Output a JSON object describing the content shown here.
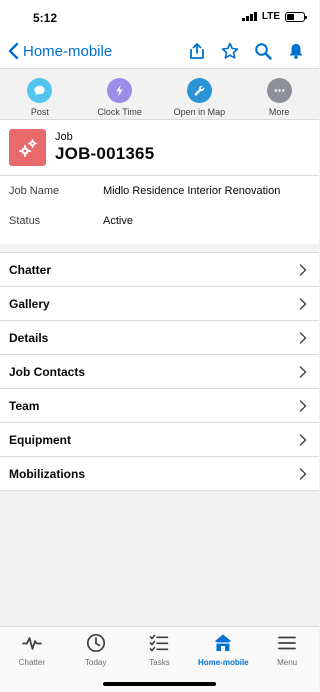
{
  "status_bar": {
    "time": "5:12",
    "network": "LTE"
  },
  "nav": {
    "back_label": "Home-mobile"
  },
  "actions": [
    {
      "label": "Post",
      "color": "#54c5ee"
    },
    {
      "label": "Clock Time",
      "color": "#9b8ee8"
    },
    {
      "label": "Open in Map",
      "color": "#2a94d6"
    },
    {
      "label": "More",
      "color": "#8b9099"
    }
  ],
  "record": {
    "type": "Job",
    "name": "JOB-001365",
    "icon_color": "#e96a6a"
  },
  "fields": [
    {
      "label": "Job Name",
      "value": "Midlo Residence Interior Renovation"
    },
    {
      "label": "Status",
      "value": "Active"
    }
  ],
  "related_lists": [
    {
      "label": "Chatter"
    },
    {
      "label": "Gallery"
    },
    {
      "label": "Details"
    },
    {
      "label": "Job Contacts"
    },
    {
      "label": "Team"
    },
    {
      "label": "Equipment"
    },
    {
      "label": "Mobilizations"
    }
  ],
  "tabs": [
    {
      "label": "Chatter",
      "icon": "pulse-icon"
    },
    {
      "label": "Today",
      "icon": "clock-icon"
    },
    {
      "label": "Tasks",
      "icon": "tasks-icon"
    },
    {
      "label": "Home-mobile",
      "icon": "home-icon",
      "active": true
    },
    {
      "label": "Menu",
      "icon": "menu-icon"
    }
  ],
  "colors": {
    "accent": "#0070d2"
  }
}
